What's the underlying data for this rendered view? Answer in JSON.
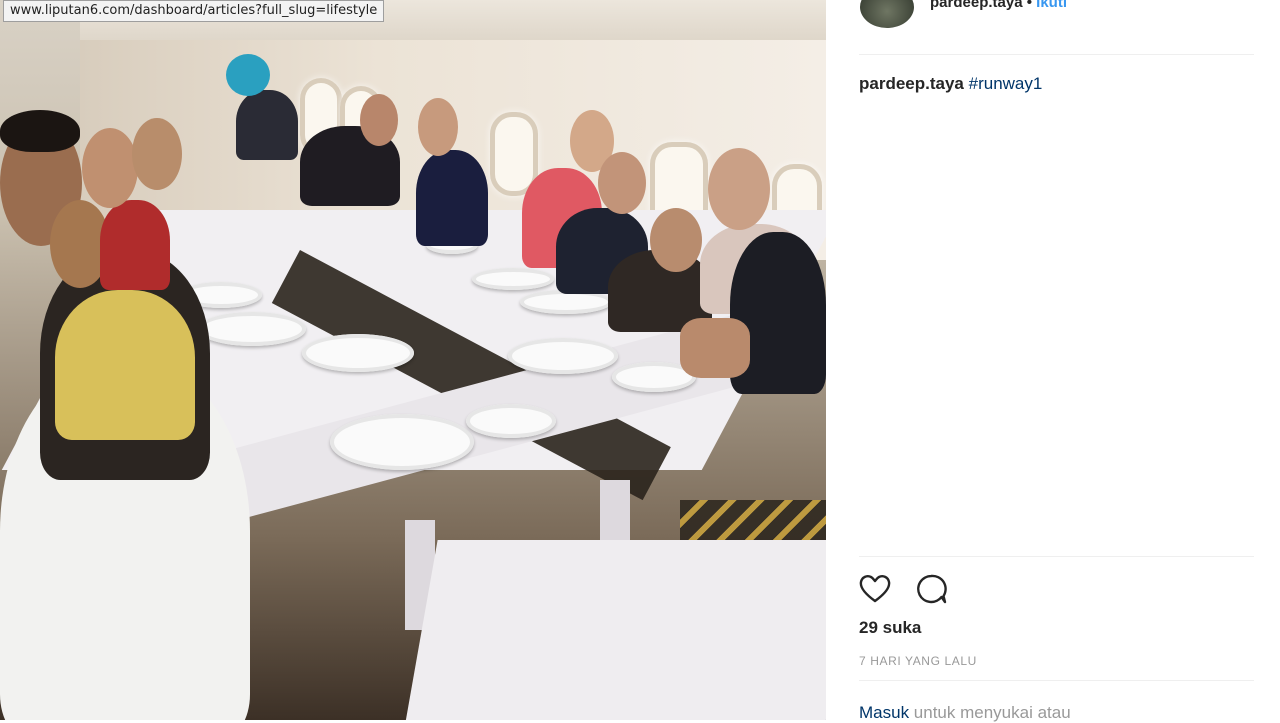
{
  "browser": {
    "status_url": "www.liputan6.com/dashboard/articles?full_slug=lifestyle"
  },
  "post": {
    "username": "pardeep.taya",
    "separator": "•",
    "follow_label": "Ikuti",
    "caption": {
      "username": "pardeep.taya",
      "hashtag": "#runway1"
    },
    "likes_text": "29 suka",
    "timestamp": "7 HARI YANG LALU",
    "login_link": "Masuk",
    "login_rest": " untuk menyukai atau"
  },
  "icons": {
    "like": "heart-icon",
    "comment": "comment-icon"
  },
  "colors": {
    "link": "#3897f0",
    "hashtag": "#003569",
    "text": "#262626",
    "muted": "#999999"
  }
}
